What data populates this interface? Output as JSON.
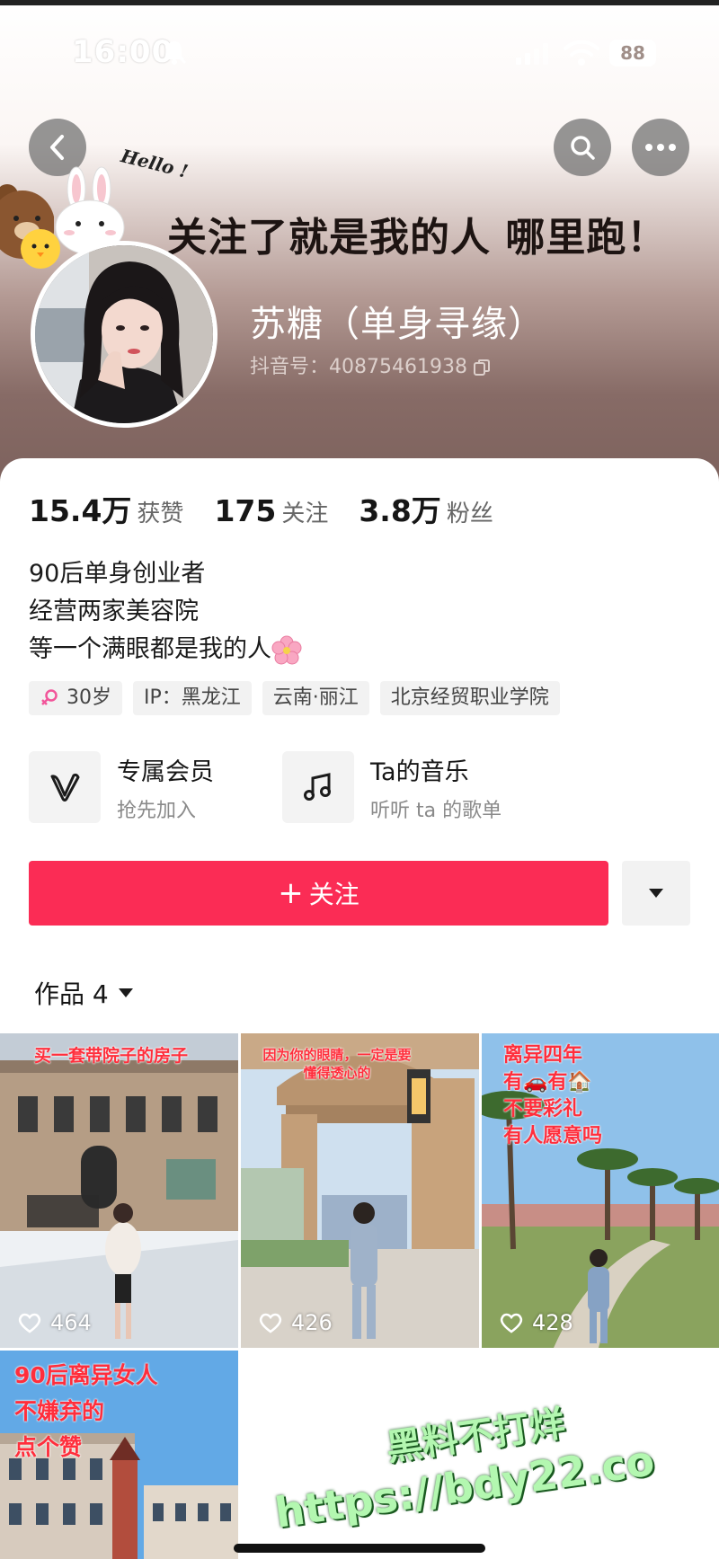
{
  "status_bar": {
    "time": "16:00",
    "battery": "88"
  },
  "banner": {
    "hello_text": "Hello !",
    "slogan": "关注了就是我的人 哪里跑！"
  },
  "profile": {
    "nickname": "苏糖（单身寻缘）",
    "douyin_id": "抖音号：40875461938"
  },
  "stats": [
    {
      "value": "15.4万",
      "label": "获赞"
    },
    {
      "value": "175",
      "label": "关注"
    },
    {
      "value": "3.8万",
      "label": "粉丝"
    }
  ],
  "bio": {
    "lines": [
      "90后单身创业者",
      "经营两家美容院",
      "等一个满眼都是我的人"
    ]
  },
  "tags": [
    "30岁",
    "IP：黑龙江",
    "云南·丽江",
    "北京经贸职业学院"
  ],
  "features": {
    "vip": {
      "title": "专属会员",
      "subtitle": "抢先加入"
    },
    "music": {
      "title": "Ta的音乐",
      "subtitle": "听听 ta 的歌单"
    }
  },
  "actions": {
    "follow_label": "关注"
  },
  "works": {
    "header": "作品 4",
    "items": [
      {
        "caption": "买一套带院子的房子",
        "likes": "464"
      },
      {
        "caption": "因为你的眼睛，一定是要懂得透心的",
        "likes": "426"
      },
      {
        "caption_lines": [
          "离异四年",
          "有🚗有🏠",
          "不要彩礼",
          "有人愿意吗"
        ],
        "likes": "428"
      },
      {
        "caption_lines": [
          "90后离异女人",
          "不嫌弃的",
          "点个赞"
        ]
      }
    ]
  },
  "watermark": {
    "line1": "黑料不打烊",
    "line2": "https://bdy22.co"
  },
  "colors": {
    "accent": "#fb2c55",
    "caption_red": "#ff2e3c"
  }
}
